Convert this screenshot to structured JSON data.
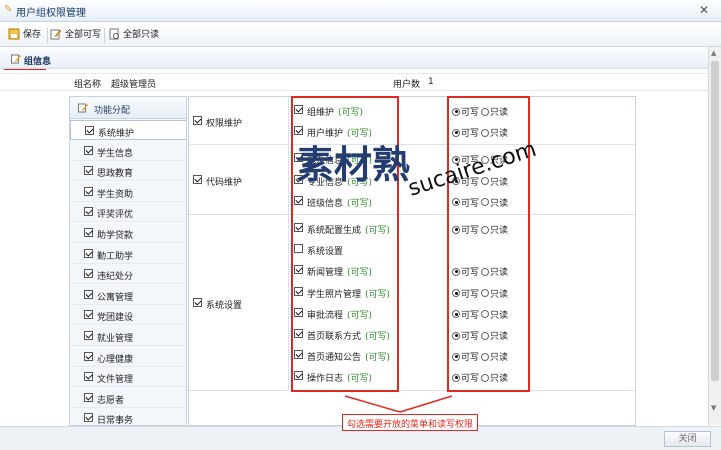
{
  "window": {
    "title": "用户组权限管理",
    "close_symbol": "✕"
  },
  "toolbar": {
    "save": "保存",
    "all_write": "全部可写",
    "all_read": "全部只读"
  },
  "section": {
    "title": "组信息"
  },
  "info": {
    "group_name_label": "组名称",
    "group_name_value": "超级管理员",
    "user_count_label": "用户数",
    "user_count_value": "1"
  },
  "left_panel": {
    "title": "功能分配",
    "items": [
      {
        "label": "系统维护",
        "checked": true,
        "selected": true
      },
      {
        "label": "学生信息",
        "checked": true
      },
      {
        "label": "思政教育",
        "checked": true
      },
      {
        "label": "学生资助",
        "checked": true
      },
      {
        "label": "评奖评优",
        "checked": true
      },
      {
        "label": "助学贷款",
        "checked": true
      },
      {
        "label": "勤工助学",
        "checked": true
      },
      {
        "label": "违纪处分",
        "checked": true
      },
      {
        "label": "公寓管理",
        "checked": true
      },
      {
        "label": "党团建设",
        "checked": true
      },
      {
        "label": "就业管理",
        "checked": true
      },
      {
        "label": "心理健康",
        "checked": true
      },
      {
        "label": "文件管理",
        "checked": true
      },
      {
        "label": "志愿者",
        "checked": true
      },
      {
        "label": "日常事务",
        "checked": true
      }
    ]
  },
  "permissions": {
    "write_label": "可写",
    "read_label": "只读",
    "write_tag": "(可写)",
    "groups": [
      {
        "label": "权限维护",
        "checked": true,
        "rows": [
          {
            "label": "组维护",
            "tag": "(可写)",
            "checked": true,
            "mode": "write"
          },
          {
            "label": "用户维护",
            "tag": "(可写)",
            "checked": true,
            "mode": "write"
          }
        ]
      },
      {
        "label": "代码维护",
        "checked": true,
        "rows": [
          {
            "label": "院系信息",
            "tag": "(可写)",
            "checked": true,
            "mode": "write"
          },
          {
            "label": "专业信息",
            "tag": "(可写)",
            "checked": true,
            "mode": "write"
          },
          {
            "label": "班级信息",
            "tag": "(可写)",
            "checked": true,
            "mode": "write"
          }
        ]
      },
      {
        "label": "系统设置",
        "checked": true,
        "rows": [
          {
            "label": "系统配置生成",
            "tag": "(可写)",
            "checked": true,
            "mode": "write"
          },
          {
            "label": "系统设置",
            "tag": "",
            "checked": false,
            "mode": "none"
          },
          {
            "label": "新闻管理",
            "tag": "(可写)",
            "checked": true,
            "mode": "write"
          },
          {
            "label": "学生照片管理",
            "tag": "(可写)",
            "checked": true,
            "mode": "write"
          },
          {
            "label": "审批流程",
            "tag": "(可写)",
            "checked": true,
            "mode": "write"
          },
          {
            "label": "首页联系方式",
            "tag": "(可写)",
            "checked": true,
            "mode": "write"
          },
          {
            "label": "首页通知公告",
            "tag": "(可写)",
            "checked": true,
            "mode": "write"
          },
          {
            "label": "操作日志",
            "tag": "(可写)",
            "checked": true,
            "mode": "write"
          }
        ]
      }
    ]
  },
  "callout": "勾选需要开放的菜单和读写权限",
  "watermark": {
    "text1": "素材熟",
    "text2": "sucaire.com"
  },
  "footer": {
    "close": "关闭"
  },
  "colors": {
    "accent_red": "#e0291f",
    "write_green": "#2d8a2d"
  }
}
